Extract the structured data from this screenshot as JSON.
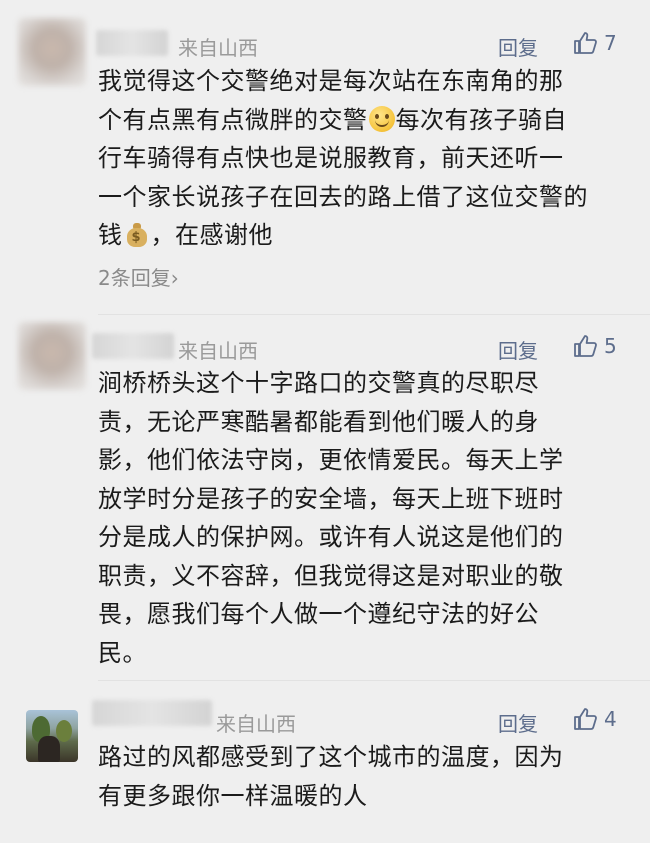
{
  "comments": [
    {
      "location": "来自山西",
      "reply_label": "回复",
      "likes": "7",
      "lines_a": [
        "我觉得这个交警绝对是每次站在东南角的那",
        "个有点黑有点微胖的交警"
      ],
      "line2_after_emoji": "每次有孩子骑自",
      "lines_b": [
        "行车骑得有点快也是说服教育，前天还听一",
        "一个家长说孩子在回去的路上借了这位交警的"
      ],
      "line5_before": "钱",
      "line5_after": "，在感谢他",
      "more_replies": "2条回复"
    },
    {
      "location": "来自山西",
      "reply_label": "回复",
      "likes": "5",
      "lines": [
        "涧桥桥头这个十字路口的交警真的尽职尽",
        "责，无论严寒酷暑都能看到他们暖人的身",
        "影，他们依法守岗，更依情爱民。每天上学",
        "放学时分是孩子的安全墙，每天上班下班时",
        "分是成人的保护网。或许有人说这是他们的",
        "职责，义不容辞，但我觉得这是对职业的敬",
        "畏，愿我们每个人做一个遵纪守法的好公",
        "民。"
      ]
    },
    {
      "location": "来自山西",
      "reply_label": "回复",
      "likes": "4",
      "lines": [
        "路过的风都感受到了这个城市的温度，因为",
        "有更多跟你一样温暖的人"
      ]
    }
  ],
  "icons": {
    "like": "thumbs-up-outline-icon",
    "chevron": "chevron-right-icon",
    "smile": "smiling-face-emoji",
    "money": "money-bag-emoji"
  },
  "colors": {
    "background": "#efefef",
    "link": "#5d6d8c",
    "meta": "#9a9a9a"
  }
}
